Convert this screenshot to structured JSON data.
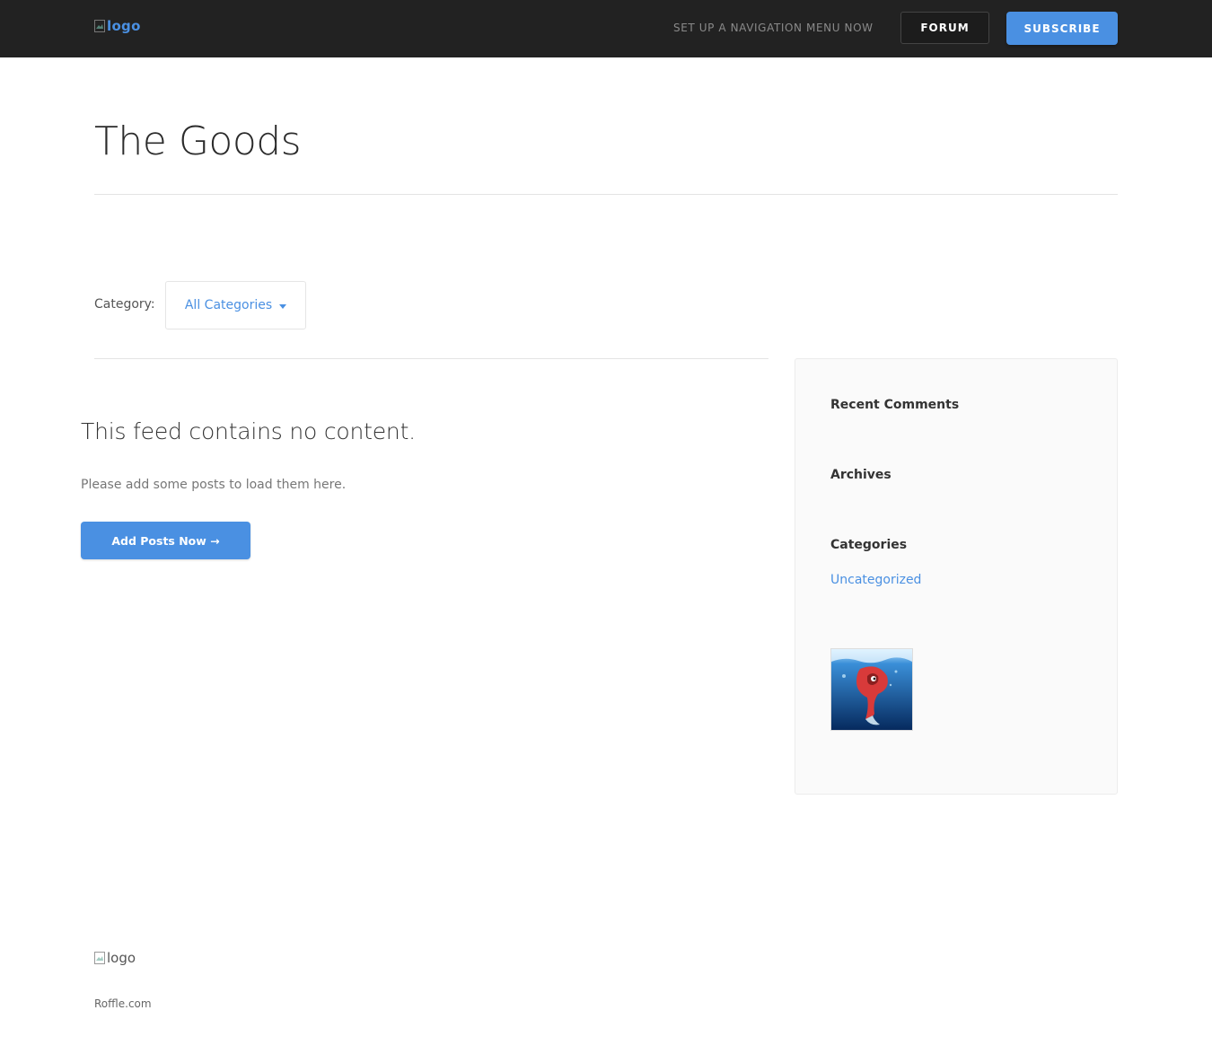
{
  "header": {
    "logo_alt": "logo",
    "nav_text": "SET UP A NAVIGATION MENU NOW",
    "forum_label": "FORUM",
    "subscribe_label": "SUBSCRIBE"
  },
  "page": {
    "title": "The Goods"
  },
  "filter": {
    "label": "Category:",
    "selected": "All Categories"
  },
  "feed": {
    "heading": "This feed contains no content.",
    "message": "Please add some posts to load them here.",
    "button_label": "Add Posts Now →"
  },
  "sidebar": {
    "recent_comments_title": "Recent Comments",
    "archives_title": "Archives",
    "categories_title": "Categories",
    "categories": [
      "Uncategorized"
    ]
  },
  "footer": {
    "logo_alt": "logo",
    "site_name": "Roffle.com"
  },
  "colors": {
    "accent": "#4a90e2",
    "header_bg": "#222222",
    "sidebar_bg": "#fafafa"
  }
}
